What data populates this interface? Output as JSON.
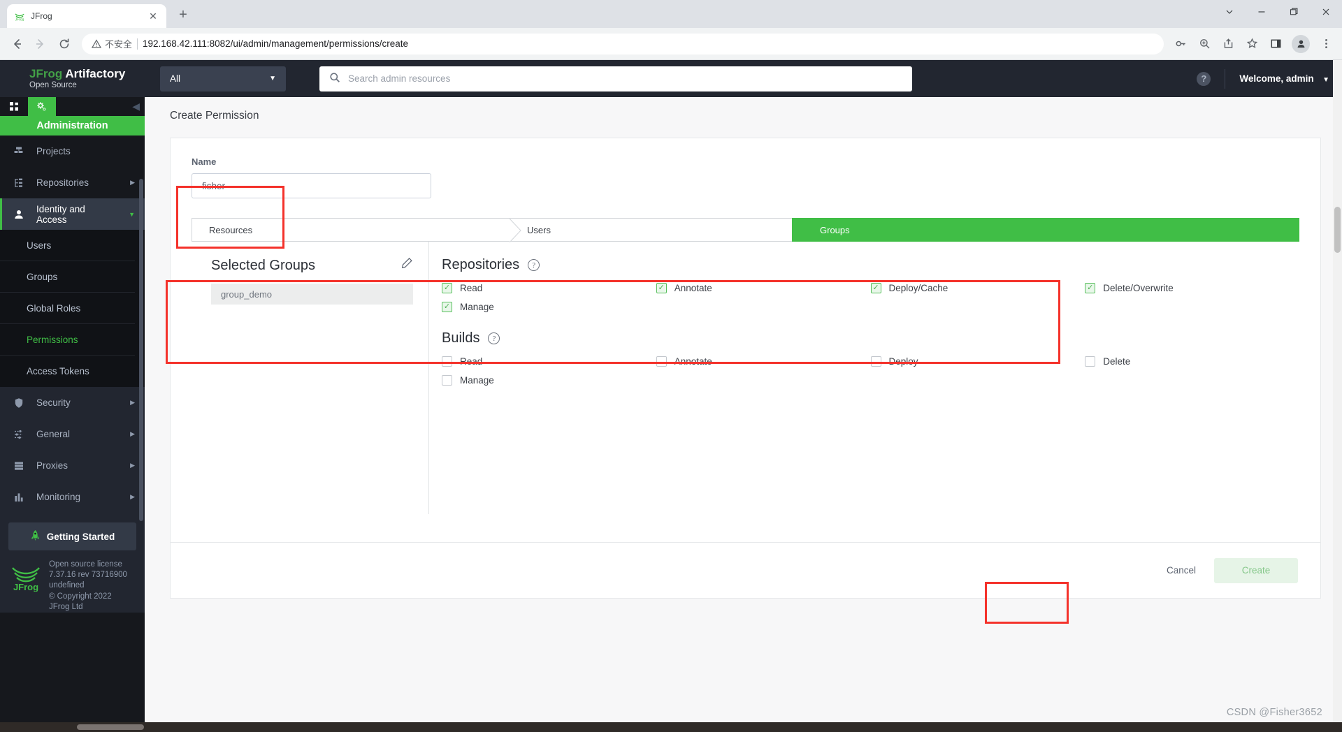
{
  "browser": {
    "tab_title": "JFrog",
    "tab_favicon": "jfrog-favicon",
    "new_tab_label": "+",
    "close_label": "✕",
    "window_controls": {
      "minimize": "—",
      "maximize": "❐",
      "close": "✕",
      "chevron": "⌄"
    },
    "nav": {
      "back": "←",
      "forward": "→",
      "reload": "↻"
    },
    "security_label": "不安全",
    "url": "192.168.42.111:8082/ui/admin/management/permissions/create",
    "toolbar_icons": [
      "key-icon",
      "zoom-icon",
      "share-icon",
      "bookmark-star-icon",
      "sidepanel-icon",
      "profile-avatar-icon",
      "more-menu-icon"
    ]
  },
  "topbar": {
    "brand_main": "Artifactory",
    "brand_prefix": "JFrog",
    "brand_sub": "Open Source",
    "scope_value": "All",
    "search_placeholder": "Search admin resources",
    "search_value": "",
    "help_label": "?",
    "welcome": "Welcome, admin"
  },
  "sidebar": {
    "mode_title": "Administration",
    "mode_icons": [
      "apps-grid-icon",
      "gears-icon"
    ],
    "items": [
      {
        "label": "Projects",
        "icon": "projects-icon",
        "caret": false
      },
      {
        "label": "Repositories",
        "icon": "repositories-icon",
        "caret": true
      },
      {
        "label": "Identity and Access",
        "icon": "user-icon",
        "caret": true,
        "active": true
      },
      {
        "label": "Security",
        "icon": "shield-icon",
        "caret": true
      },
      {
        "label": "General",
        "icon": "sliders-icon",
        "caret": true
      },
      {
        "label": "Proxies",
        "icon": "server-icon",
        "caret": true
      },
      {
        "label": "Monitoring",
        "icon": "bar-chart-icon",
        "caret": true
      }
    ],
    "submenu": [
      {
        "label": "Users"
      },
      {
        "label": "Groups"
      },
      {
        "label": "Global Roles"
      },
      {
        "label": "Permissions",
        "active": true
      },
      {
        "label": "Access Tokens"
      }
    ],
    "getting_started": "Getting Started",
    "license": [
      "Open source license",
      "7.37.16 rev 73716900",
      "undefined",
      "© Copyright 2022",
      "JFrog Ltd"
    ]
  },
  "main": {
    "page_title": "Create Permission",
    "name_label": "Name",
    "name_value": "fisher",
    "tabs": [
      {
        "label": "Resources",
        "active": false
      },
      {
        "label": "Users",
        "active": false
      },
      {
        "label": "Groups",
        "active": true
      }
    ],
    "selected_groups": {
      "title": "Selected Groups",
      "edit_icon": "pencil-icon",
      "groups": [
        "group_demo"
      ]
    },
    "permission_sections": [
      {
        "title": "Repositories",
        "help": "?",
        "checkboxes": [
          {
            "label": "Read",
            "checked": true
          },
          {
            "label": "Annotate",
            "checked": true
          },
          {
            "label": "Deploy/Cache",
            "checked": true
          },
          {
            "label": "Delete/Overwrite",
            "checked": true
          },
          {
            "label": "Manage",
            "checked": true
          }
        ]
      },
      {
        "title": "Builds",
        "help": "?",
        "checkboxes": [
          {
            "label": "Read",
            "checked": false
          },
          {
            "label": "Annotate",
            "checked": false
          },
          {
            "label": "Deploy",
            "checked": false
          },
          {
            "label": "Delete",
            "checked": false
          },
          {
            "label": "Manage",
            "checked": false
          }
        ]
      }
    ],
    "footer": {
      "cancel": "Cancel",
      "create": "Create"
    }
  },
  "watermark": "CSDN @Fisher3652",
  "colors": {
    "brand_green": "#40be46",
    "annotation_red": "#f4322b",
    "dark_nav": "#16181d",
    "dark_panel": "#222630"
  }
}
